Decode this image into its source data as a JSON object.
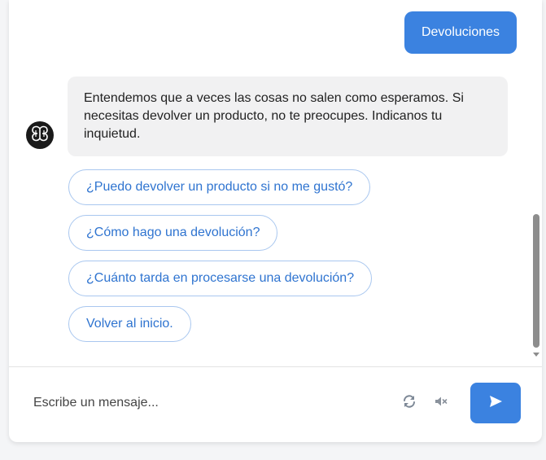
{
  "user_message": {
    "text": "Devoluciones"
  },
  "bot_message": {
    "avatar_icon": "butterfly-logo-icon",
    "text": "Entendemos que a veces las cosas no salen como esperamos. Si necesitas devolver un producto, no te preocupes. Indicanos tu inquietud."
  },
  "quick_replies": [
    {
      "label": "¿Puedo devolver un producto si no me gustó?"
    },
    {
      "label": "¿Cómo hago una devolución?"
    },
    {
      "label": "¿Cuánto tarda en procesarse una devolución?"
    },
    {
      "label": "Volver al inicio."
    }
  ],
  "composer": {
    "placeholder": "Escribe un mensaje...",
    "refresh_icon": "refresh-icon",
    "mute_icon": "volume-mute-icon",
    "send_icon": "send-icon"
  },
  "colors": {
    "accent": "#3b82e0",
    "bot_bubble": "#f1f1f2",
    "quick_reply_border": "#a9c7ef",
    "quick_reply_text": "#2f74d0"
  }
}
